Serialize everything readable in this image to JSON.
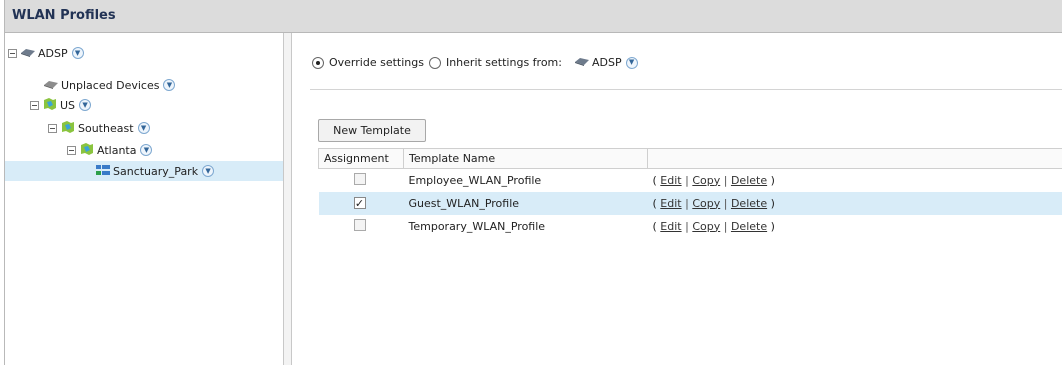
{
  "panel": {
    "title": "WLAN Profiles"
  },
  "tree": {
    "root": "ADSP",
    "unplaced": "Unplaced Devices",
    "country": "US",
    "region": "Southeast",
    "city": "Atlanta",
    "site": "Sanctuary_Park"
  },
  "settings": {
    "override_label": "Override settings",
    "inherit_label": "Inherit settings from:",
    "inherit_source": "ADSP",
    "selected": "override"
  },
  "toolbar": {
    "new_template": "New Template"
  },
  "table": {
    "headers": [
      "Assignment",
      "Template Name",
      ""
    ],
    "rows": [
      {
        "assigned": false,
        "name": "Employee_WLAN_Profile",
        "actions": [
          "Edit",
          "Copy",
          "Delete"
        ]
      },
      {
        "assigned": true,
        "name": "Guest_WLAN_Profile",
        "actions": [
          "Edit",
          "Copy",
          "Delete"
        ]
      },
      {
        "assigned": false,
        "name": "Temporary_WLAN_Profile",
        "actions": [
          "Edit",
          "Copy",
          "Delete"
        ]
      }
    ]
  },
  "glyphs": {
    "open": "(",
    "close": ")",
    "bar": "|",
    "check": "✓",
    "chev": "▼"
  },
  "colors": {
    "selection": "#d8ecf8",
    "title": "#223355"
  }
}
